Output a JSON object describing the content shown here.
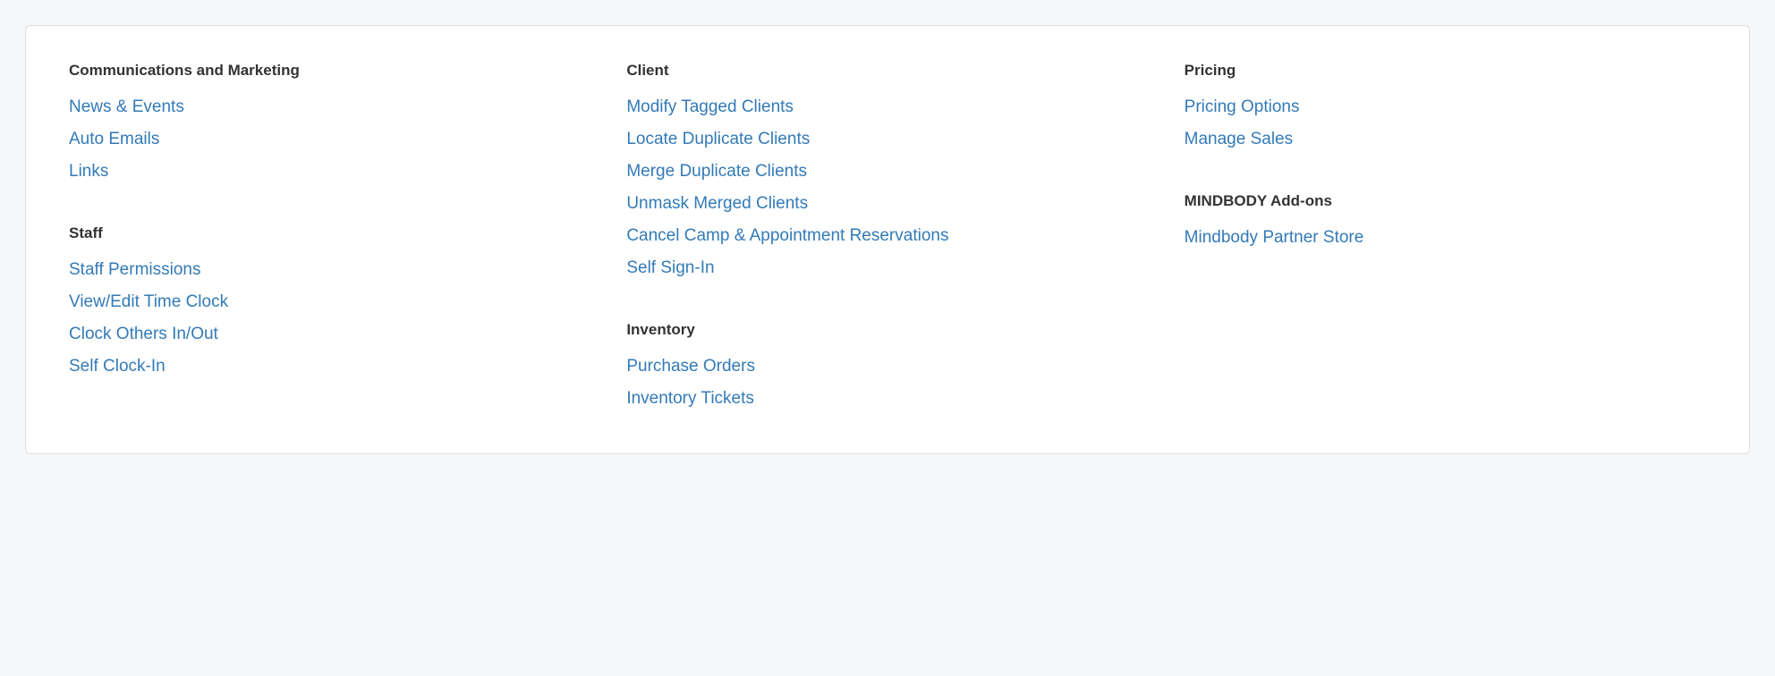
{
  "columns": [
    {
      "sections": [
        {
          "title": "Communications and Marketing",
          "name": "communications-and-marketing",
          "links": [
            {
              "label": "News & Events",
              "name": "news-and-events"
            },
            {
              "label": "Auto Emails",
              "name": "auto-emails"
            },
            {
              "label": "Links",
              "name": "links"
            }
          ]
        },
        {
          "title": "Staff",
          "name": "staff",
          "links": [
            {
              "label": "Staff Permissions",
              "name": "staff-permissions"
            },
            {
              "label": "View/Edit Time Clock",
              "name": "view-edit-time-clock"
            },
            {
              "label": "Clock Others In/Out",
              "name": "clock-others-in-out"
            },
            {
              "label": "Self Clock-In",
              "name": "self-clock-in"
            }
          ]
        }
      ]
    },
    {
      "sections": [
        {
          "title": "Client",
          "name": "client",
          "links": [
            {
              "label": "Modify Tagged Clients",
              "name": "modify-tagged-clients"
            },
            {
              "label": "Locate Duplicate Clients",
              "name": "locate-duplicate-clients"
            },
            {
              "label": "Merge Duplicate Clients",
              "name": "merge-duplicate-clients"
            },
            {
              "label": "Unmask Merged Clients",
              "name": "unmask-merged-clients"
            },
            {
              "label": "Cancel Camp & Appointment Reservations",
              "name": "cancel-camp-appointment-reservations"
            },
            {
              "label": "Self Sign-In",
              "name": "self-sign-in"
            }
          ]
        },
        {
          "title": "Inventory",
          "name": "inventory",
          "links": [
            {
              "label": "Purchase Orders",
              "name": "purchase-orders"
            },
            {
              "label": "Inventory Tickets",
              "name": "inventory-tickets"
            }
          ]
        }
      ]
    },
    {
      "sections": [
        {
          "title": "Pricing",
          "name": "pricing",
          "links": [
            {
              "label": "Pricing Options",
              "name": "pricing-options"
            },
            {
              "label": "Manage Sales",
              "name": "manage-sales"
            }
          ]
        },
        {
          "title": "MINDBODY Add-ons",
          "name": "mindbody-addons",
          "links": [
            {
              "label": "Mindbody Partner Store",
              "name": "mindbody-partner-store"
            }
          ]
        }
      ]
    }
  ]
}
